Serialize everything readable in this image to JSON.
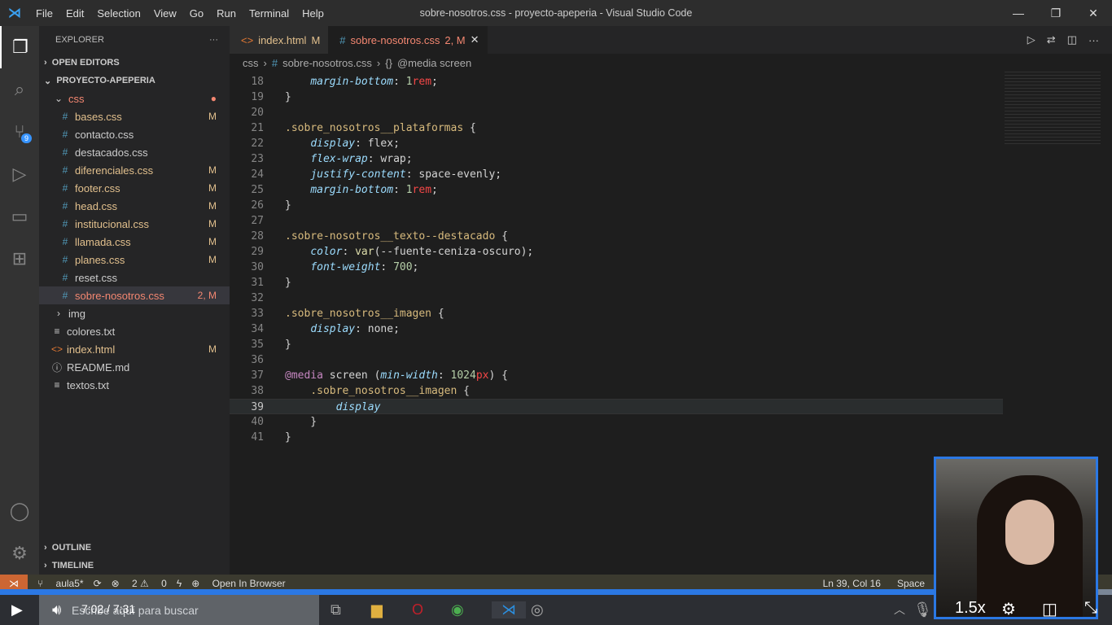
{
  "window": {
    "title": "sobre-nosotros.css - proyecto-apeperia - Visual Studio Code",
    "menu": [
      "File",
      "Edit",
      "Selection",
      "View",
      "Go",
      "Run",
      "Terminal",
      "Help"
    ]
  },
  "sidebar": {
    "title": "EXPLORER",
    "open_editors": "OPEN EDITORS",
    "project": "PROYECTO-APEPERIA",
    "items": [
      {
        "label": "css",
        "type": "folder",
        "status": "●"
      },
      {
        "label": "bases.css",
        "type": "css",
        "status": "M"
      },
      {
        "label": "contacto.css",
        "type": "css",
        "status": ""
      },
      {
        "label": "destacados.css",
        "type": "css",
        "status": ""
      },
      {
        "label": "diferenciales.css",
        "type": "css",
        "status": "M"
      },
      {
        "label": "footer.css",
        "type": "css",
        "status": "M"
      },
      {
        "label": "head.css",
        "type": "css",
        "status": "M"
      },
      {
        "label": "institucional.css",
        "type": "css",
        "status": "M"
      },
      {
        "label": "llamada.css",
        "type": "css",
        "status": "M"
      },
      {
        "label": "planes.css",
        "type": "css",
        "status": "M"
      },
      {
        "label": "reset.css",
        "type": "css",
        "status": ""
      },
      {
        "label": "sobre-nosotros.css",
        "type": "css",
        "status": "2, M"
      },
      {
        "label": "img",
        "type": "folder-closed",
        "status": ""
      },
      {
        "label": "colores.txt",
        "type": "txt",
        "status": ""
      },
      {
        "label": "index.html",
        "type": "html",
        "status": "M"
      },
      {
        "label": "README.md",
        "type": "info",
        "status": ""
      },
      {
        "label": "textos.txt",
        "type": "txt",
        "status": ""
      }
    ],
    "outline": "OUTLINE",
    "timeline": "TIMELINE"
  },
  "tabs": [
    {
      "label": "index.html",
      "status": "M"
    },
    {
      "label": "sobre-nosotros.css",
      "status": "2, M"
    }
  ],
  "breadcrumb": {
    "folder": "css",
    "file": "sobre-nosotros.css",
    "symbol": "@media screen"
  },
  "code": [
    {
      "n": "18",
      "t": [
        [
          "    ",
          "punc"
        ],
        [
          "margin-bottom",
          "prop"
        ],
        [
          ": ",
          "punc"
        ],
        [
          "1",
          "num"
        ],
        [
          "rem",
          "unit"
        ],
        [
          ";",
          "punc"
        ]
      ]
    },
    {
      "n": "19",
      "t": [
        [
          "}",
          "punc"
        ]
      ]
    },
    {
      "n": "20",
      "t": []
    },
    {
      "n": "21",
      "t": [
        [
          ".sobre_nosotros__plataformas",
          "sel"
        ],
        [
          " {",
          "punc"
        ]
      ]
    },
    {
      "n": "22",
      "t": [
        [
          "    ",
          "punc"
        ],
        [
          "display",
          "prop"
        ],
        [
          ": ",
          "punc"
        ],
        [
          "flex",
          "kw"
        ],
        [
          ";",
          "punc"
        ]
      ]
    },
    {
      "n": "23",
      "t": [
        [
          "    ",
          "punc"
        ],
        [
          "flex-wrap",
          "prop"
        ],
        [
          ": ",
          "punc"
        ],
        [
          "wrap",
          "kw"
        ],
        [
          ";",
          "punc"
        ]
      ]
    },
    {
      "n": "24",
      "t": [
        [
          "    ",
          "punc"
        ],
        [
          "justify-content",
          "prop"
        ],
        [
          ": ",
          "punc"
        ],
        [
          "space-evenly",
          "kw"
        ],
        [
          ";",
          "punc"
        ]
      ]
    },
    {
      "n": "25",
      "t": [
        [
          "    ",
          "punc"
        ],
        [
          "margin-bottom",
          "prop"
        ],
        [
          ": ",
          "punc"
        ],
        [
          "1",
          "num"
        ],
        [
          "rem",
          "unit"
        ],
        [
          ";",
          "punc"
        ]
      ]
    },
    {
      "n": "26",
      "t": [
        [
          "}",
          "punc"
        ]
      ]
    },
    {
      "n": "27",
      "t": []
    },
    {
      "n": "28",
      "t": [
        [
          ".sobre-nosotros__texto--destacado",
          "sel"
        ],
        [
          " {",
          "punc"
        ]
      ]
    },
    {
      "n": "29",
      "t": [
        [
          "    ",
          "punc"
        ],
        [
          "color",
          "prop"
        ],
        [
          ": ",
          "punc"
        ],
        [
          "var",
          "var"
        ],
        [
          "(--fuente-ceniza-oscuro);",
          "punc"
        ]
      ]
    },
    {
      "n": "30",
      "t": [
        [
          "    ",
          "punc"
        ],
        [
          "font-weight",
          "prop"
        ],
        [
          ": ",
          "punc"
        ],
        [
          "700",
          "num"
        ],
        [
          ";",
          "punc"
        ]
      ]
    },
    {
      "n": "31",
      "t": [
        [
          "}",
          "punc"
        ]
      ]
    },
    {
      "n": "32",
      "t": []
    },
    {
      "n": "33",
      "t": [
        [
          ".sobre_nosotros__imagen",
          "sel"
        ],
        [
          " {",
          "punc"
        ]
      ]
    },
    {
      "n": "34",
      "t": [
        [
          "    ",
          "punc"
        ],
        [
          "display",
          "prop"
        ],
        [
          ": ",
          "punc"
        ],
        [
          "none",
          "kw"
        ],
        [
          ";",
          "punc"
        ]
      ]
    },
    {
      "n": "35",
      "t": [
        [
          "}",
          "punc"
        ]
      ]
    },
    {
      "n": "36",
      "t": []
    },
    {
      "n": "37",
      "t": [
        [
          "@media",
          "at"
        ],
        [
          " screen (",
          "punc"
        ],
        [
          "min-width",
          "prop"
        ],
        [
          ": ",
          "punc"
        ],
        [
          "1024",
          "num"
        ],
        [
          "px",
          "unit"
        ],
        [
          ") {",
          "punc"
        ]
      ]
    },
    {
      "n": "38",
      "t": [
        [
          "    ",
          "punc"
        ],
        [
          ".sobre_nosotros__imagen",
          "sel"
        ],
        [
          " {",
          "punc"
        ]
      ]
    },
    {
      "n": "39",
      "t": [
        [
          "        ",
          "punc"
        ],
        [
          "display",
          "prop"
        ]
      ]
    },
    {
      "n": "40",
      "t": [
        [
          "    }",
          "punc"
        ]
      ]
    },
    {
      "n": "41",
      "t": [
        [
          "}",
          "punc"
        ]
      ]
    }
  ],
  "current_line": "39",
  "status": {
    "branch": "aula5*",
    "errors": "2",
    "warnings": "0",
    "open_browser": "Open In Browser",
    "position": "Ln 39, Col 16",
    "spaces": "Space"
  },
  "video": {
    "time": "7:02  /  7:31",
    "progress": 0.935,
    "speed": "1.5x"
  },
  "taskbar": {
    "search_placeholder": "Escribe aquí para buscar"
  },
  "colors": {
    "accent": "#2b78e4",
    "remote": "#cc6633"
  }
}
